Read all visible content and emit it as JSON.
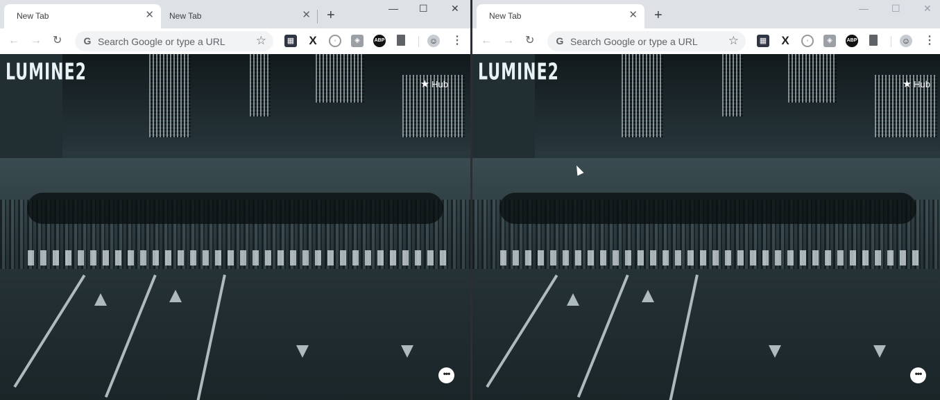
{
  "windows": [
    {
      "tabs": [
        {
          "title": "New Tab",
          "active": true
        },
        {
          "title": "New Tab",
          "active": false
        }
      ],
      "new_tab_symbol": "+",
      "controls": {
        "minimize": "—",
        "maximize": "☐",
        "close": "✕"
      },
      "omnibox": {
        "placeholder": "Search Google or type a URL"
      },
      "hub_label": "Hub",
      "extensions": [
        "grid-ext-icon",
        "x-ext-icon",
        "circle-ext-icon",
        "puzzle-ext-icon",
        "abp-icon",
        "bookmark-ext-icon"
      ],
      "abp_text": "ABP"
    },
    {
      "tabs": [
        {
          "title": "New Tab",
          "active": true
        }
      ],
      "new_tab_symbol": "+",
      "controls": {
        "minimize": "—",
        "maximize": "☐",
        "close": "✕"
      },
      "omnibox": {
        "placeholder": "Search Google or type a URL"
      },
      "hub_label": "Hub",
      "extensions": [
        "grid-ext-icon",
        "x-ext-icon",
        "circle-ext-icon",
        "puzzle-ext-icon",
        "abp-icon",
        "bookmark-ext-icon"
      ],
      "abp_text": "ABP"
    }
  ],
  "background": {
    "sign_text": "LUMINE2"
  },
  "colors": {
    "tabstrip": "#dee1e6",
    "toolbar": "#ffffff",
    "omnibox": "#f1f3f4",
    "content_dark": "#1c2a2e"
  }
}
